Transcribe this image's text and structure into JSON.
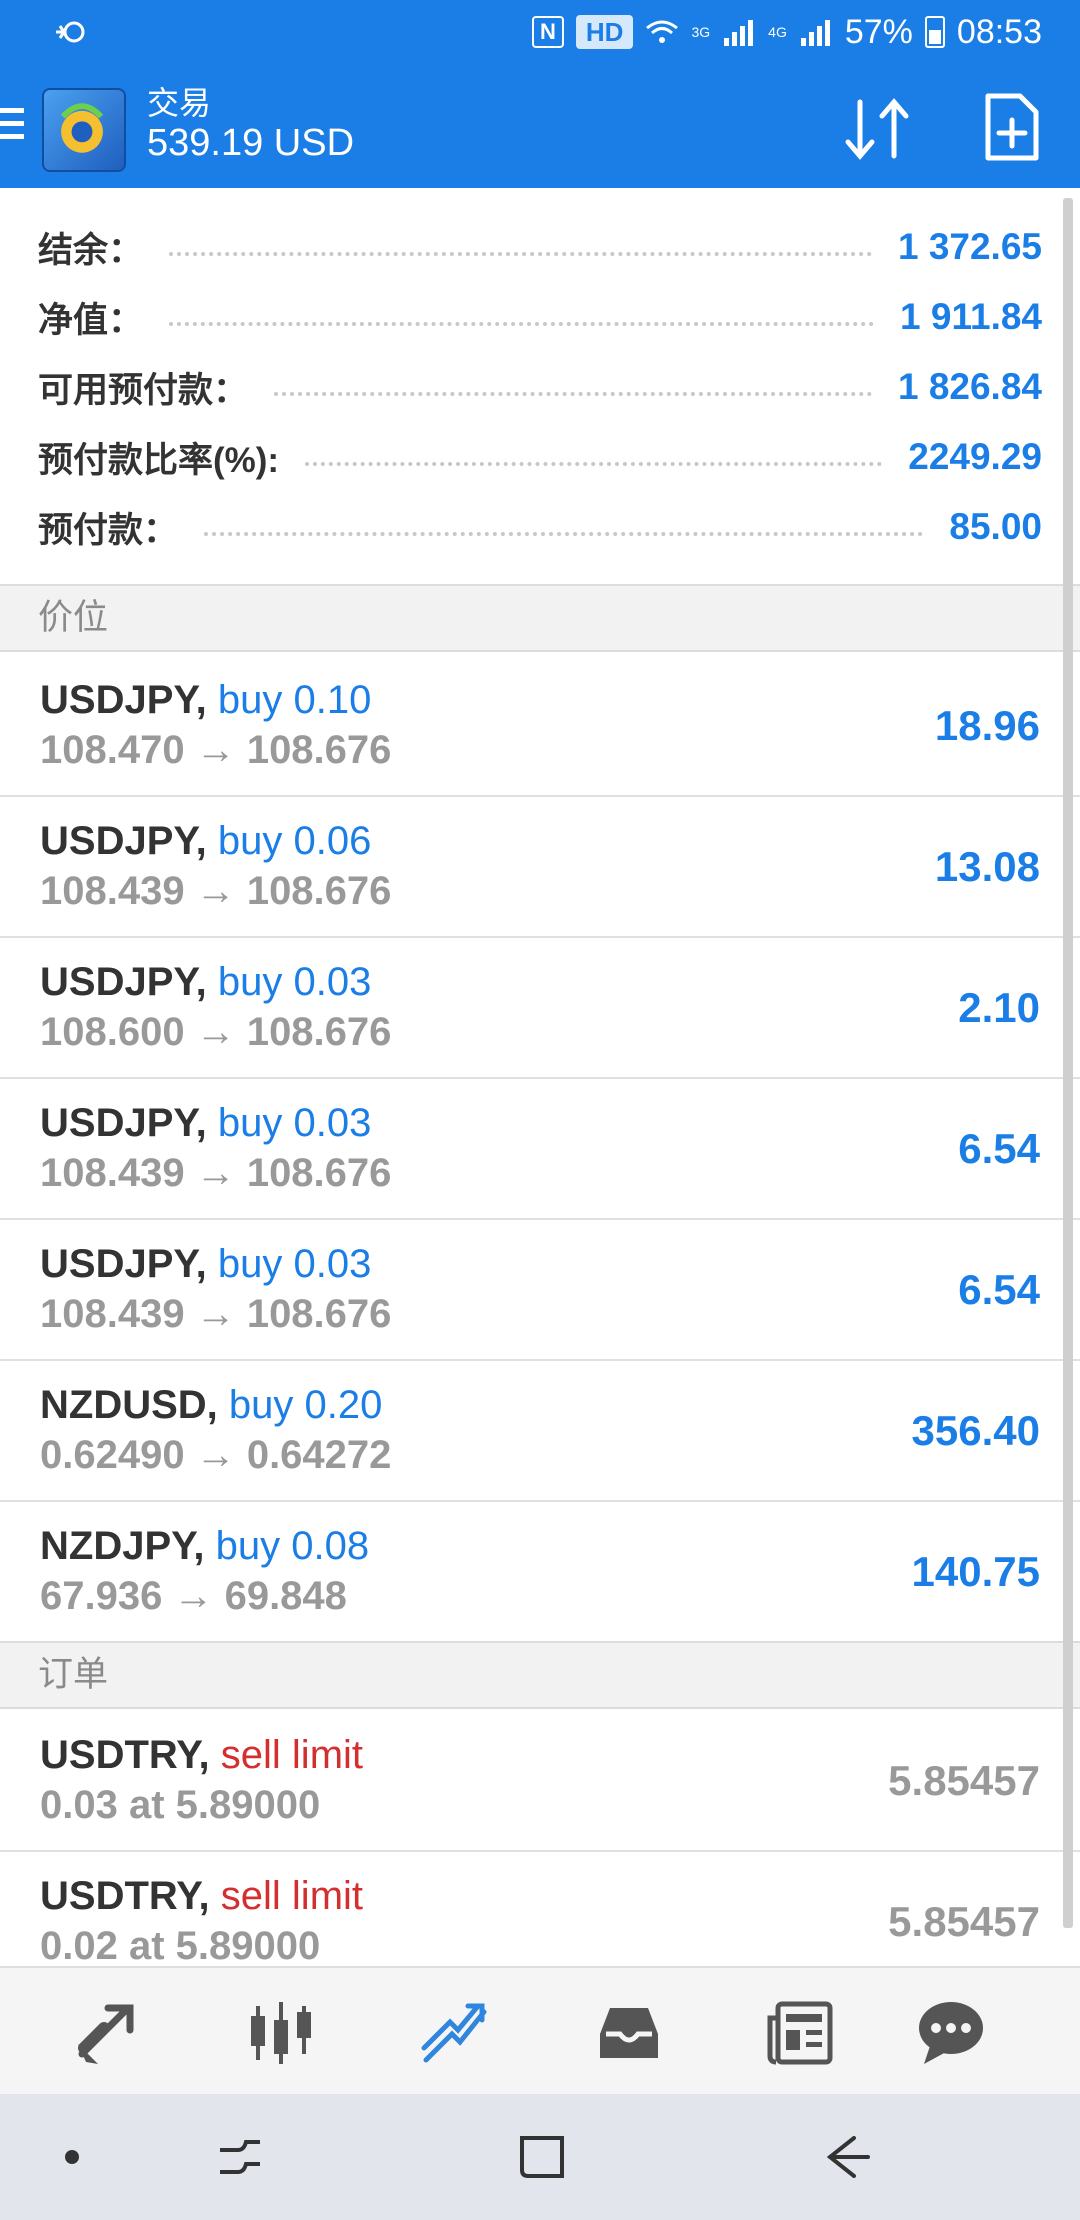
{
  "status_bar": {
    "hd_label": "HD",
    "net_3g": "3G",
    "net_4g": "4G",
    "battery": "57%",
    "time": "08:53"
  },
  "header": {
    "title": "交易",
    "balance": "539.19 USD"
  },
  "summary": [
    {
      "label": "结余：",
      "value": "1 372.65"
    },
    {
      "label": "净值：",
      "value": "1 911.84"
    },
    {
      "label": "可用预付款：",
      "value": "1 826.84"
    },
    {
      "label": "预付款比率(%):",
      "value": "2249.29"
    },
    {
      "label": "预付款：",
      "value": "85.00"
    }
  ],
  "positions_title": "价位",
  "positions": [
    {
      "symbol": "USDJPY,",
      "action": "buy 0.10",
      "prices": "108.470 → 108.676",
      "profit": "18.96"
    },
    {
      "symbol": "USDJPY,",
      "action": "buy 0.06",
      "prices": "108.439 → 108.676",
      "profit": "13.08"
    },
    {
      "symbol": "USDJPY,",
      "action": "buy 0.03",
      "prices": "108.600 → 108.676",
      "profit": "2.10"
    },
    {
      "symbol": "USDJPY,",
      "action": "buy 0.03",
      "prices": "108.439 → 108.676",
      "profit": "6.54"
    },
    {
      "symbol": "USDJPY,",
      "action": "buy 0.03",
      "prices": "108.439 → 108.676",
      "profit": "6.54"
    },
    {
      "symbol": "NZDUSD,",
      "action": "buy 0.20",
      "prices": "0.62490 → 0.64272",
      "profit": "356.40"
    },
    {
      "symbol": "NZDJPY,",
      "action": "buy 0.08",
      "prices": "67.936 → 69.848",
      "profit": "140.75"
    }
  ],
  "orders_title": "订单",
  "orders": [
    {
      "symbol": "USDTRY,",
      "action": "sell limit",
      "detail": "0.03 at 5.89000",
      "price": "5.85457"
    },
    {
      "symbol": "USDTRY,",
      "action": "sell limit",
      "detail": "0.02 at 5.89000",
      "price": "5.85457"
    }
  ],
  "tabs": [
    {
      "icon": "quotes-arrows-icon"
    },
    {
      "icon": "chart-candles-icon"
    },
    {
      "icon": "trade-trend-icon",
      "active": true
    },
    {
      "icon": "history-inbox-icon"
    },
    {
      "icon": "news-icon"
    },
    {
      "icon": "chat-icon"
    }
  ],
  "colors": {
    "primary": "#1a7ee6",
    "sell": "#d32f2f",
    "muted": "#999999"
  }
}
